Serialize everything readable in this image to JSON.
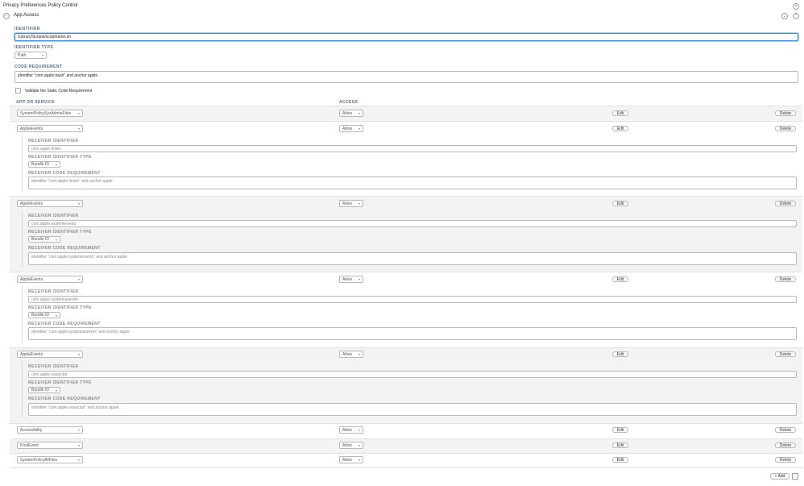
{
  "window": {
    "title": "Privacy Preferences Policy Control"
  },
  "section": {
    "title": "App Access"
  },
  "form": {
    "identifier_label": "IDENTIFIER",
    "identifier_value": "/Library/Scripts/scriptname.sh",
    "identifier_type_label": "IDENTIFIER TYPE",
    "identifier_type_value": "Path",
    "code_req_label": "CODE REQUIREMENT",
    "code_req_value": "identifier \"com.apple.bash\" and anchor apple",
    "validate_label": "Validate the Static Code Requirement"
  },
  "table": {
    "col_app": "APP OR SERVICE",
    "col_access": "ACCESS",
    "edit_label": "Edit",
    "delete_label": "Delete",
    "receiver_identifier_label": "RECEIVER IDENTIFIER",
    "receiver_identifier_type_label": "RECEIVER IDENTIFIER TYPE",
    "receiver_code_req_label": "RECEIVER CODE REQUIREMENT",
    "rows": [
      {
        "service": "SystemPolicySysAdminFiles",
        "access": "Allow"
      },
      {
        "service": "AppleEvents",
        "access": "Allow",
        "receiver_identifier": "com.apple.finder",
        "receiver_type": "Bundle ID",
        "receiver_code": "identifier \"com.apple.finder\" and anchor apple"
      },
      {
        "service": "AppleEvents",
        "access": "Allow",
        "receiver_identifier": "com.apple.systemevents",
        "receiver_type": "Bundle ID",
        "receiver_code": "identifier \"com.apple.systemevents\" and anchor apple"
      },
      {
        "service": "AppleEvents",
        "access": "Allow",
        "receiver_identifier": "com.apple.systemuiserver",
        "receiver_type": "Bundle ID",
        "receiver_code": "identifier \"com.apple.systemuiserver\" and anchor apple"
      },
      {
        "service": "AppleEvents",
        "access": "Allow",
        "receiver_identifier": "com.apple.osascript",
        "receiver_type": "Bundle ID",
        "receiver_code": "identifier \"com.apple.osascript\" and anchor apple"
      },
      {
        "service": "Accessibility",
        "access": "Allow"
      },
      {
        "service": "PostEvent",
        "access": "Allow"
      },
      {
        "service": "SystemPolicyAllFiles",
        "access": "Allow"
      }
    ]
  },
  "footer": {
    "add_label": "+ Add"
  }
}
